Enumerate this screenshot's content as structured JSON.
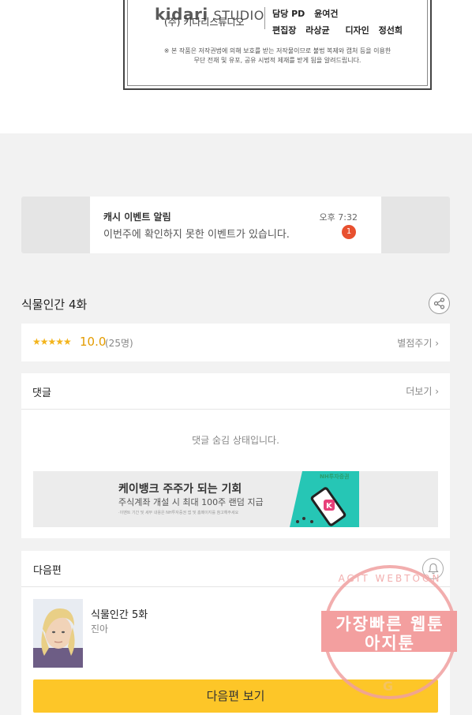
{
  "credits": {
    "logo_brand": "kidari",
    "logo_suffix": "STUDIO",
    "company_kor": "(주) 키다리스튜디오",
    "pd_label": "담당 PD",
    "pd_name": "윤여건",
    "editor_label": "편집장",
    "editor_name": "라상균",
    "designer_label": "디자인",
    "designer_name": "정선희",
    "notice_line1": "※ 본 작품은 저작권법에 의해 보호를 받는 저작물이므로 불법 복제와 캡처 등을 이용한",
    "notice_line2": "무단 전재 및 유포, 공유 시법적 제재를 받게 됨을 알려드립니다."
  },
  "event": {
    "title": "캐시 이벤트 알림",
    "message": "이번주에 확인하지 못한 이벤트가 있습니다.",
    "time": "오후 7:32",
    "badge": "1"
  },
  "episode": {
    "title": "식물인간 4화"
  },
  "rating": {
    "stars": "★★★★★",
    "score": "10.0",
    "count": "(25명)",
    "rate_link": "별점주기 ›"
  },
  "comments": {
    "title": "댓글",
    "more": "더보기 ›",
    "hidden_text": "댓글 숨김 상태입니다."
  },
  "ad": {
    "title": "케이뱅크 주주가 되는 기회",
    "subtitle": "주식계좌 개설 시 최대 100주 랜덤 지급",
    "fine_print": "·이벤트 기간 및 세부 내용은 NH투자증권 앱 및 홈페이지를 참고해주세요",
    "brand": "NH투자증권",
    "brand_color": "#2a9d6e",
    "accent_color": "#26c6b5"
  },
  "next": {
    "title": "다음편",
    "episode_title": "식물인간 5화",
    "author": "진아",
    "button_label": "다음편 보기",
    "button_color": "#fdc628"
  },
  "watermark": {
    "top_text": "AGIT WEBTOON",
    "line1": "가장빠른 웹툰",
    "line2": "아지툰",
    "color": "#f18f8f"
  }
}
